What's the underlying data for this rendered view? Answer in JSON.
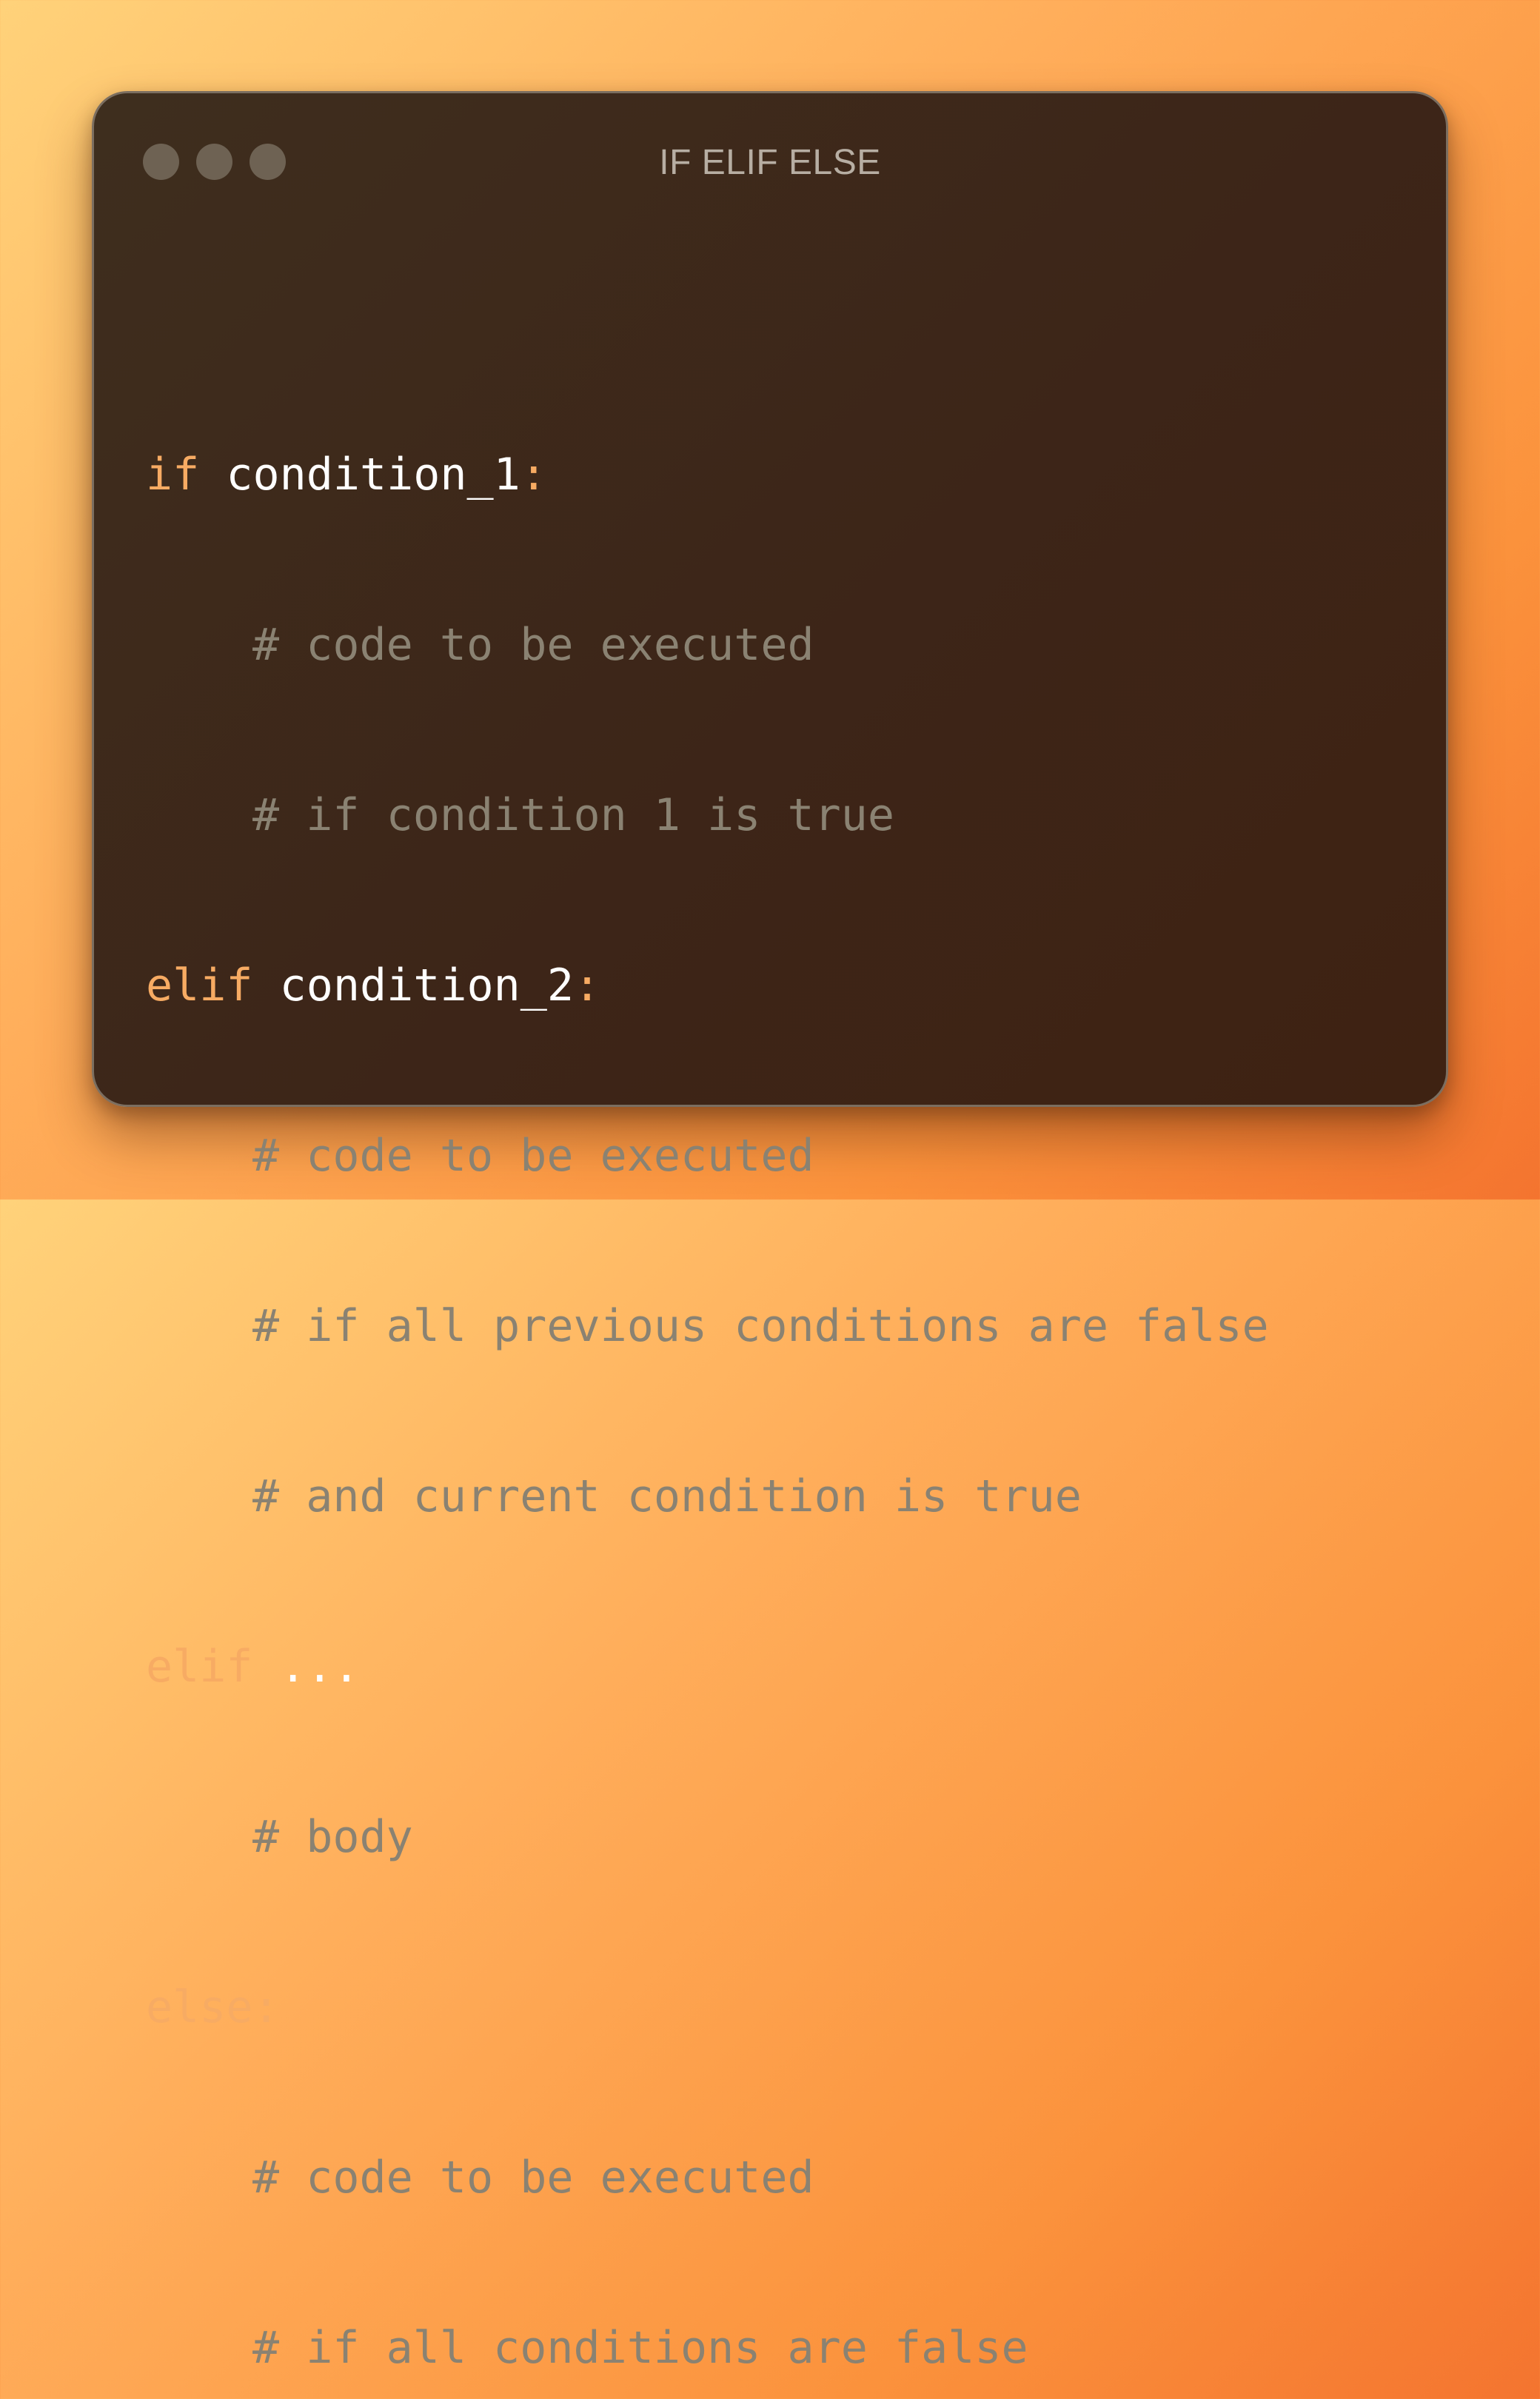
{
  "window": {
    "title": "IF ELIF ELSE"
  },
  "code": {
    "lines": [
      {
        "keyword": "if",
        "expr": "condition_1",
        "punct": ":"
      },
      {
        "comment": "# code to be executed"
      },
      {
        "comment": "# if condition 1 is true"
      },
      {
        "keyword": "elif",
        "expr": "condition_2",
        "punct": ":"
      },
      {
        "comment": "# code to be executed"
      },
      {
        "comment": "# if all previous conditions are false"
      },
      {
        "comment": "# and current condition is true"
      },
      {
        "keyword": "elif",
        "expr": "..."
      },
      {
        "comment": "# body"
      },
      {
        "keyword": "else",
        "punct": ":"
      },
      {
        "comment": "# code to be executed"
      },
      {
        "comment": "# if all conditions are false"
      }
    ]
  },
  "colors": {
    "keyword": "#f7ab63",
    "identifier": "#ffffff",
    "comment": "#8a8272",
    "window_bg": "#3d2818",
    "traffic_light": "#6e6253"
  }
}
